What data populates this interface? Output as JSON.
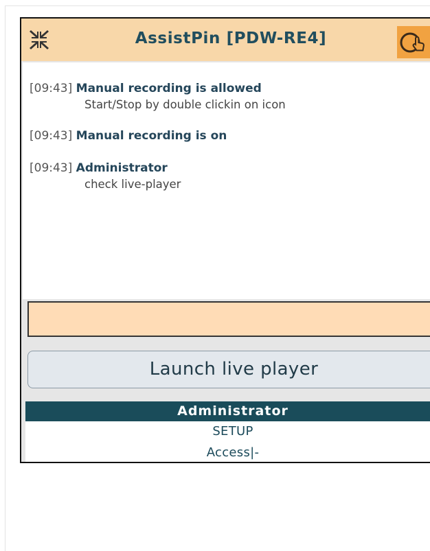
{
  "header": {
    "title": "AssistPin [PDW-RE4]",
    "minimize_icon": "collapse-arrows-icon",
    "status_icon": "touch-circle-icon"
  },
  "log": [
    {
      "time": "[09:43]",
      "message": "Manual recording is allowed",
      "detail": "Start/Stop by double clickin on icon"
    },
    {
      "time": "[09:43]",
      "message": "Manual recording is on",
      "detail": ""
    },
    {
      "time": "[09:43]",
      "message": "Administrator",
      "detail": "check live-player"
    }
  ],
  "input": {
    "value": "",
    "placeholder": ""
  },
  "launch_button": {
    "label": "Launch live player"
  },
  "role": {
    "label": "Administrator"
  },
  "menu": {
    "setup_label": "SETUP",
    "access_label": "Access|-"
  },
  "colors": {
    "header_bg": "#f8d7a9",
    "title": "#214e5e",
    "status_button": "#f1a241",
    "role_bar": "#1a4c5a",
    "input_bg": "#ffdcb6"
  }
}
